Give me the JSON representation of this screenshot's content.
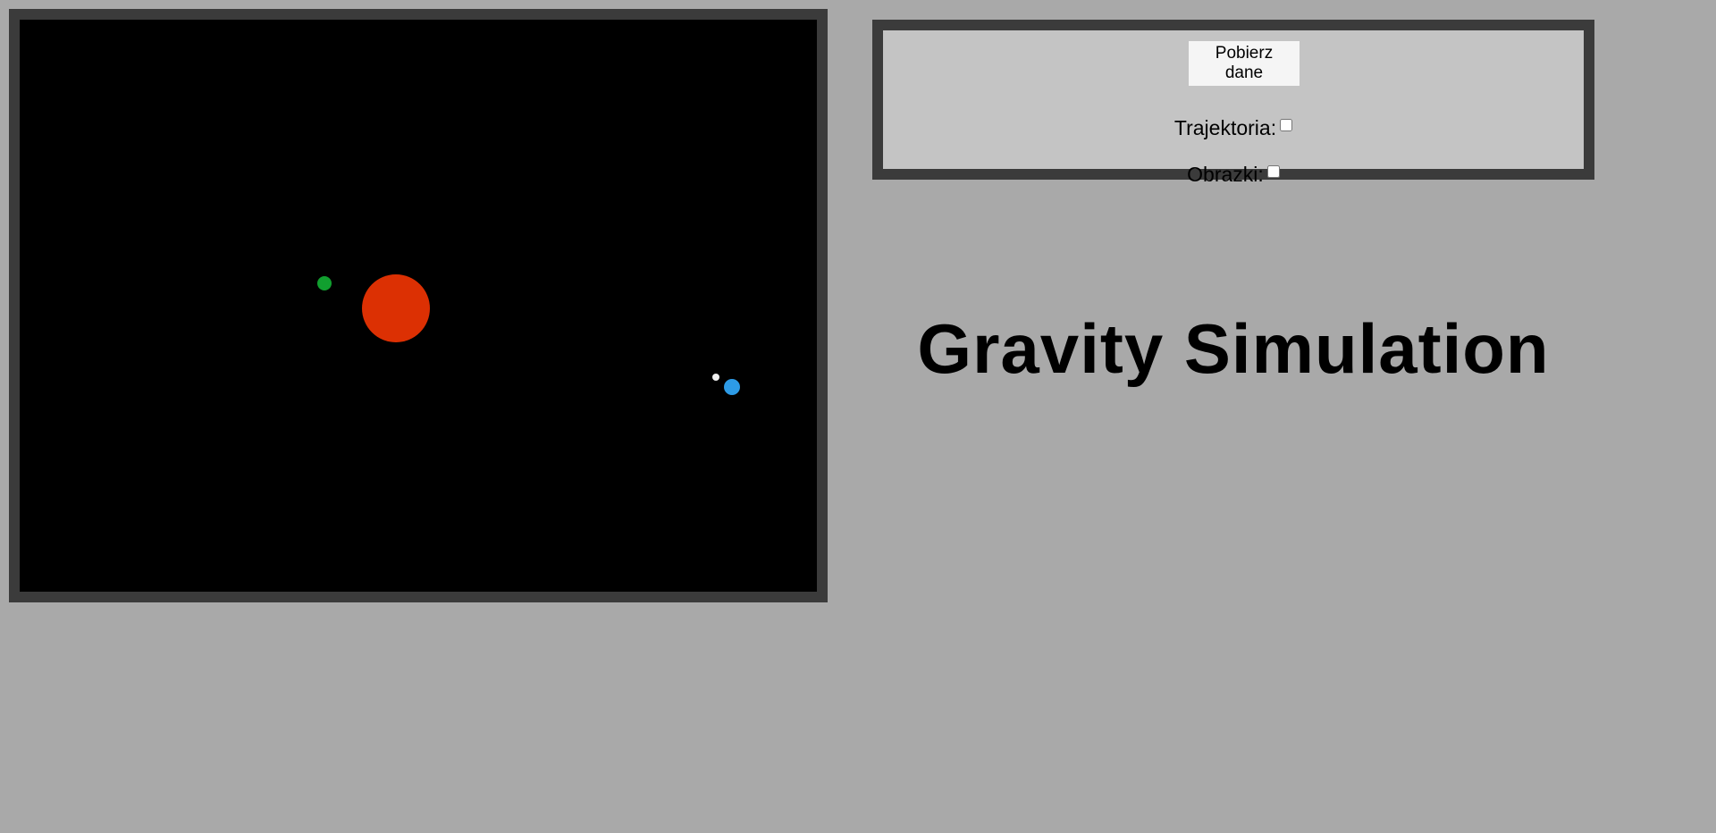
{
  "simulation": {
    "background_color": "#000000",
    "bodies": [
      {
        "name": "green-planet",
        "color": "#119f2f"
      },
      {
        "name": "red-sun",
        "color": "#dc3003"
      },
      {
        "name": "white-moon",
        "color": "#f0f0f0"
      },
      {
        "name": "blue-planet",
        "color": "#2d9be6"
      }
    ]
  },
  "controls": {
    "fetch_button_label": "Pobierz dane",
    "trajectory_label": "Trajektoria:",
    "trajectory_checked": false,
    "images_label": "Obrazki:",
    "images_checked": false
  },
  "page": {
    "title": "Gravity Simulation"
  }
}
